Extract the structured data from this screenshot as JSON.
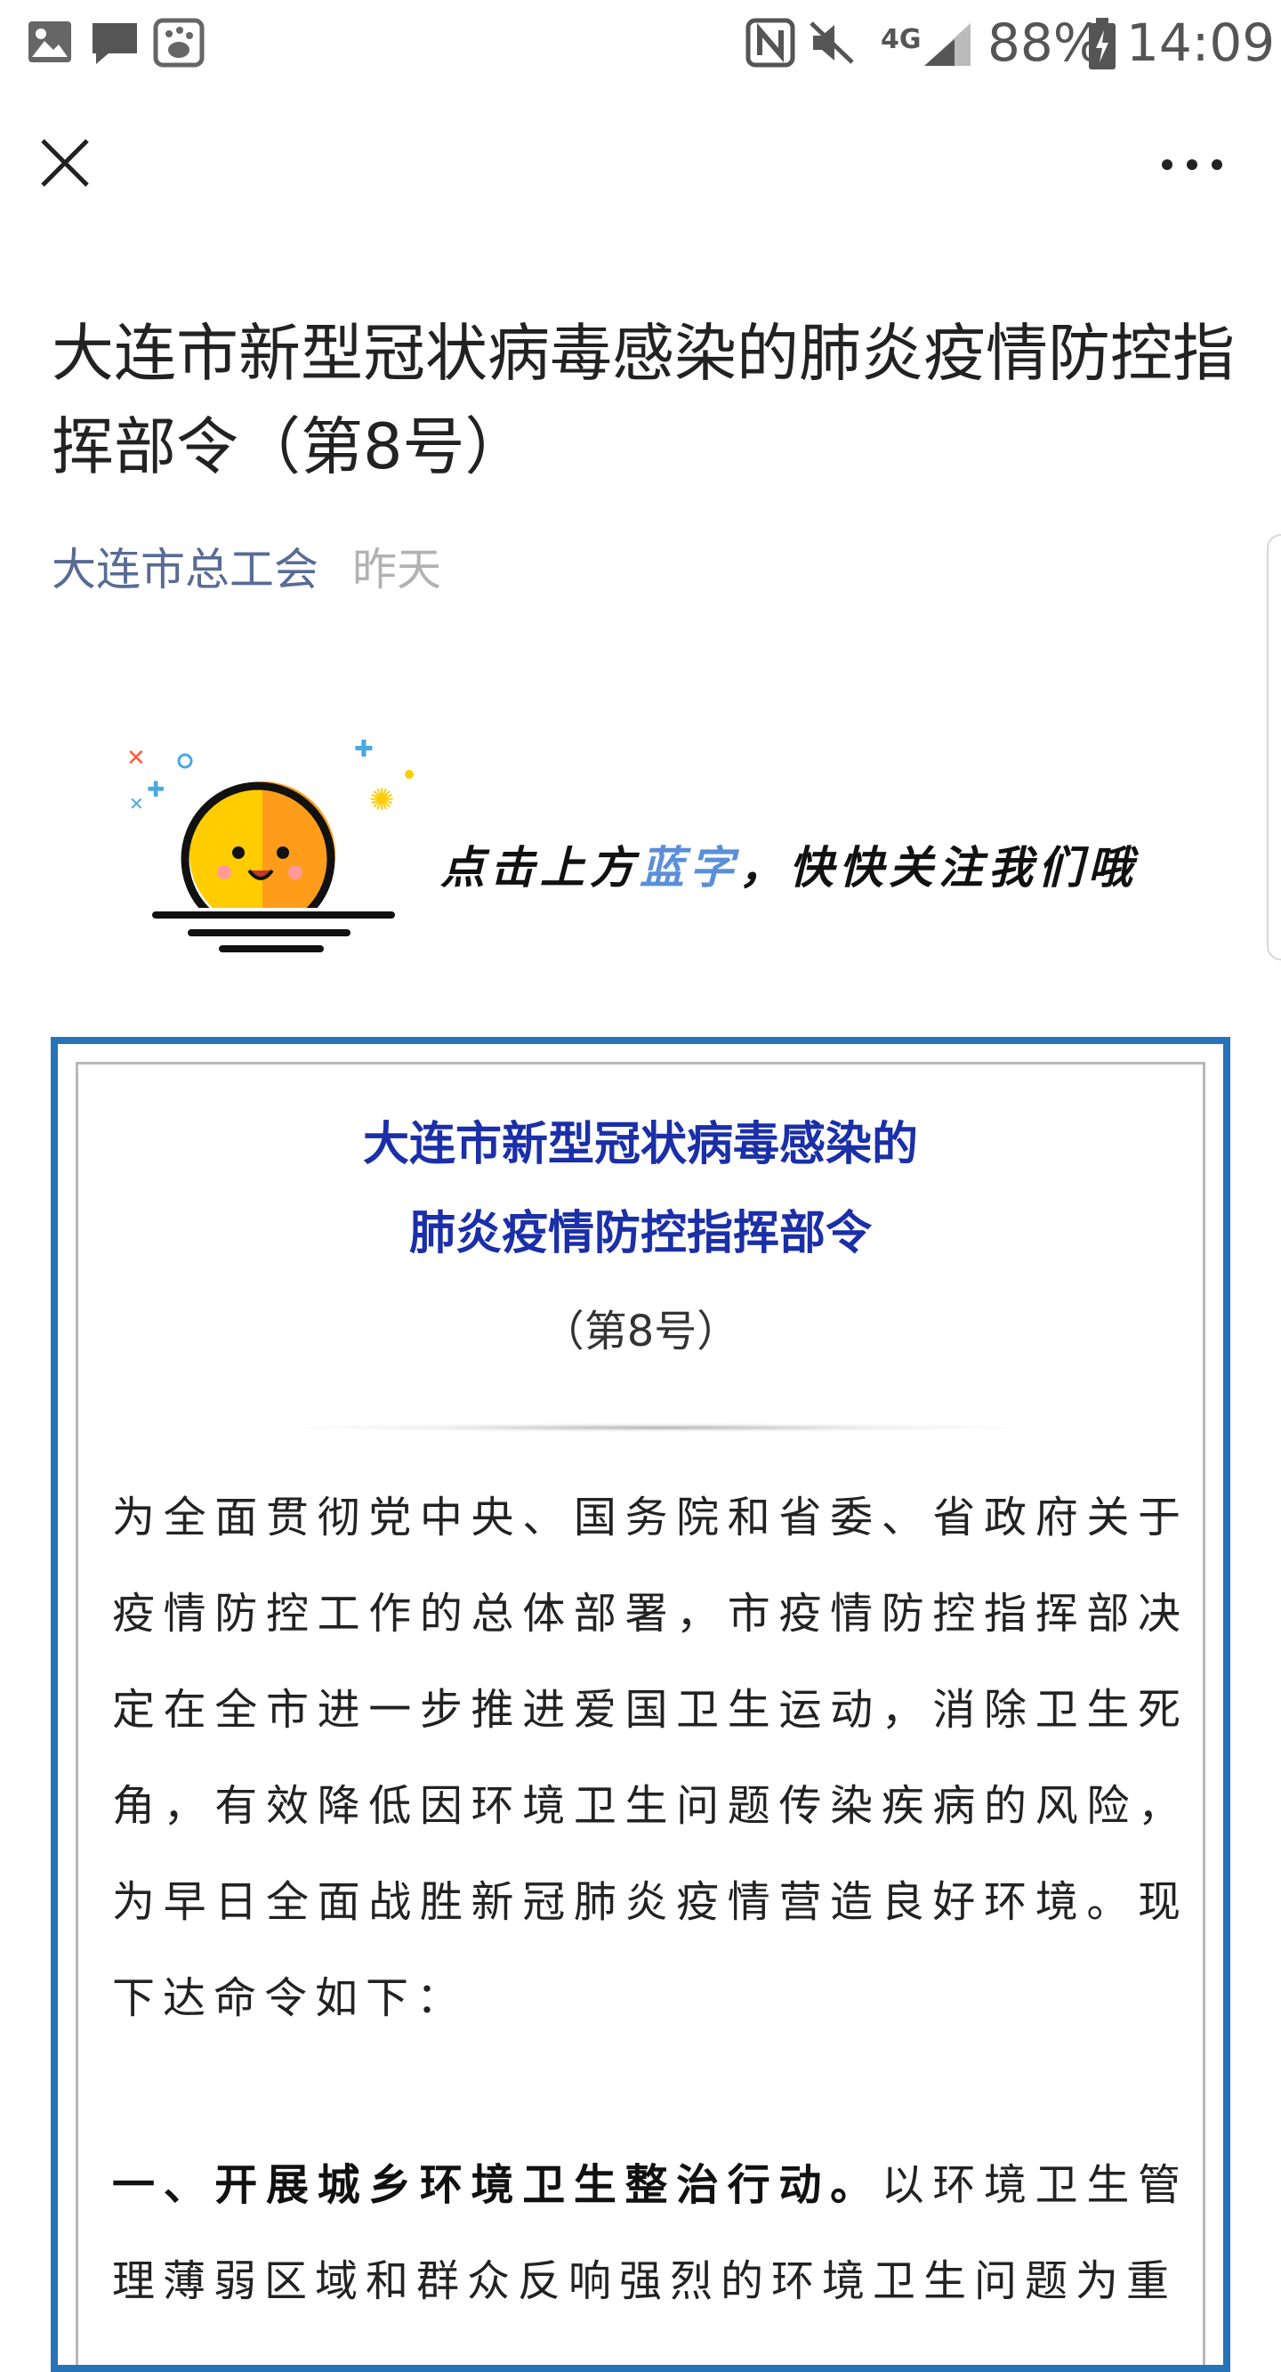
{
  "status_bar": {
    "battery": "88%",
    "time": "14:09",
    "network": "4G",
    "icons": [
      "gallery-icon",
      "message-icon",
      "baidu-icon",
      "nfc-icon",
      "mute-icon",
      "signal-icon",
      "battery-icon"
    ]
  },
  "nav": {
    "close_icon": "close-icon",
    "more_icon": "more-icon"
  },
  "article": {
    "title": "大连市新型冠状病毒感染的肺炎疫情防控指挥部令（第8号）",
    "author": "大连市总工会",
    "date": "昨天"
  },
  "banner": {
    "text_before": "点击上方",
    "text_blue": "蓝字",
    "text_after": "，快快关注我们哦",
    "accent_color": "#5a8fd8"
  },
  "document": {
    "title_line1": "大连市新型冠状病毒感染的",
    "title_line2": "肺炎疫情防控指挥部令",
    "number": "（第8号）",
    "intro": "为全面贯彻党中央、国务院和省委、省政府关于疫情防控工作的总体部署，市疫情防控指挥部决定在全市进一步推进爱国卫生运动，消除卫生死角，有效降低因环境卫生问题传染疾病的风险，为早日全面战胜新冠肺炎疫情营造良好环境。现下达命令如下：",
    "section1_heading": "一、开展城乡环境卫生整治行动。",
    "section1_text": "以环境卫生管理薄弱区域和群众反响强烈的环境卫生问题为重",
    "border_color": "#2673b8",
    "title_color": "#1b2fa8"
  }
}
